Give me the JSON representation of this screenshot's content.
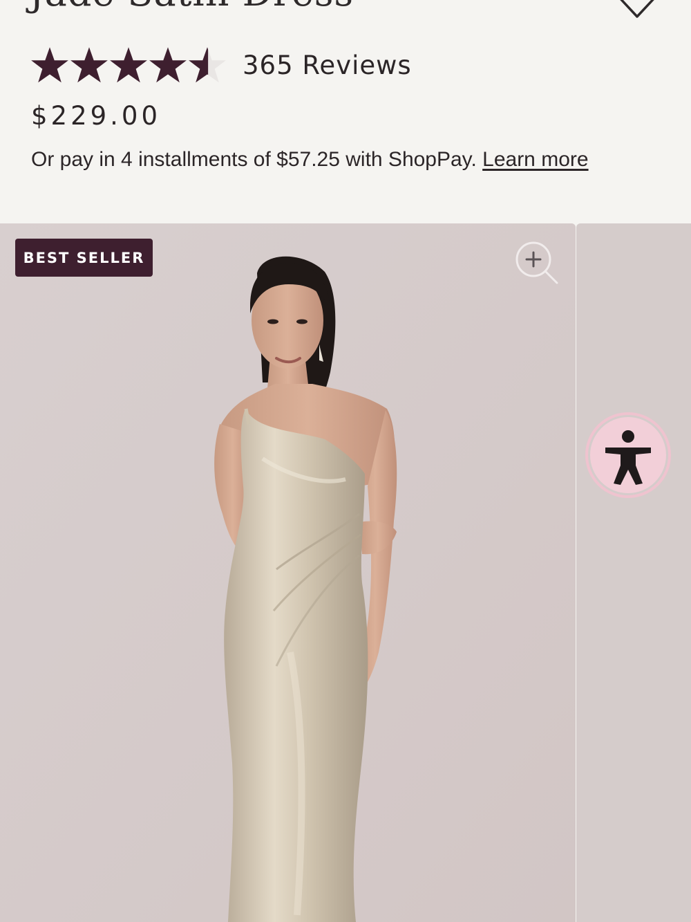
{
  "product": {
    "title": "Jade Satin Dress",
    "rating_value": 4.5,
    "rating_max": 5,
    "reviews_label": "365 Reviews",
    "price": "$229.00",
    "installments_text": "Or pay in 4 installments of $57.25 with ShopPay. ",
    "learn_more": "Learn more"
  },
  "gallery": {
    "badge": "BEST SELLER"
  },
  "icons": {
    "wishlist": "heart-outline-icon",
    "zoom": "zoom-in-icon",
    "accessibility": "accessibility-icon",
    "star": "star-icon"
  },
  "colors": {
    "background": "#f5f4f1",
    "star": "#3e1f2f",
    "badge": "#3e1f2f",
    "photo_background": "#d7cdcd",
    "accessibility_button": "#f2cfd8"
  }
}
